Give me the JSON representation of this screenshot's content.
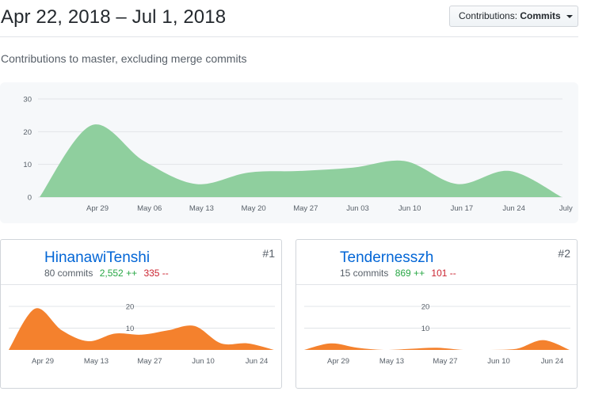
{
  "header": {
    "date_range": "Apr 22, 2018 – Jul 1, 2018",
    "dropdown_label": "Contributions:",
    "dropdown_value": "Commits"
  },
  "subtitle": "Contributions to master, excluding merge commits",
  "colors": {
    "main_area": "#8fcf9e",
    "contributor_area": "#f4812d",
    "link": "#0366d6",
    "additions": "#28a745",
    "deletions": "#cb2431"
  },
  "chart_data": [
    {
      "type": "area",
      "title": "",
      "xlabel": "",
      "ylabel": "",
      "x_ticks": [
        "Apr 29",
        "May 06",
        "May 13",
        "May 20",
        "May 27",
        "Jun 03",
        "Jun 10",
        "Jun 17",
        "Jun 24",
        "July"
      ],
      "y_ticks": [
        0,
        10,
        20,
        30
      ],
      "ylim": [
        0,
        30
      ],
      "grid": true,
      "x": [
        "Apr 22",
        "Apr 29",
        "May 06",
        "May 13",
        "May 20",
        "May 27",
        "Jun 03",
        "Jun 10",
        "Jun 17",
        "Jun 24",
        "Jul 01"
      ],
      "series": [
        {
          "values": [
            0,
            22,
            11,
            4,
            7.5,
            8,
            9,
            11,
            4,
            8,
            0
          ]
        }
      ]
    },
    {
      "type": "area",
      "title": "",
      "x_ticks": [
        "Apr 29",
        "May 13",
        "May 27",
        "Jun 10",
        "Jun 24"
      ],
      "y_ticks": [
        10,
        20
      ],
      "ylim": [
        0,
        20
      ],
      "x": [
        "Apr 22",
        "Apr 29",
        "May 06",
        "May 13",
        "May 20",
        "May 27",
        "Jun 03",
        "Jun 10",
        "Jun 17",
        "Jun 24",
        "Jul 01"
      ],
      "series": [
        {
          "values": [
            0,
            19,
            9,
            4,
            7.5,
            7,
            9,
            11,
            3,
            3,
            0
          ]
        }
      ]
    },
    {
      "type": "area",
      "title": "",
      "x_ticks": [
        "Apr 29",
        "May 13",
        "May 27",
        "Jun 10",
        "Jun 24"
      ],
      "y_ticks": [
        10,
        20
      ],
      "ylim": [
        0,
        20
      ],
      "x": [
        "Apr 22",
        "Apr 29",
        "May 06",
        "May 13",
        "May 20",
        "May 27",
        "Jun 03",
        "Jun 10",
        "Jun 17",
        "Jun 24",
        "Jul 01"
      ],
      "series": [
        {
          "values": [
            0,
            3,
            1,
            0,
            0.5,
            1,
            0,
            0,
            0.5,
            4.5,
            0
          ]
        }
      ]
    }
  ],
  "contributors": [
    {
      "rank": "#1",
      "name": "HinanawiTenshi",
      "commits": "80 commits",
      "additions": "2,552 ++",
      "deletions": "335 --"
    },
    {
      "rank": "#2",
      "name": "Tendernesszh",
      "commits": "15 commits",
      "additions": "869 ++",
      "deletions": "101 --"
    }
  ]
}
